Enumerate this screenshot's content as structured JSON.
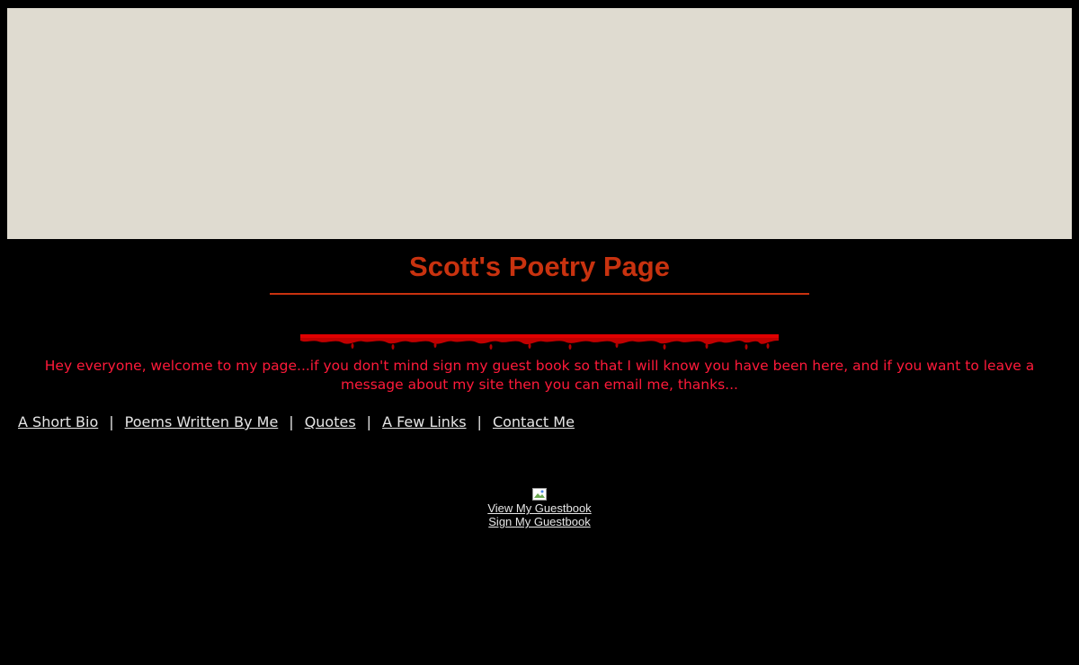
{
  "page": {
    "title": "Scott's Poetry Page",
    "welcome_text": "Hey everyone, welcome to my page...if you don't mind sign my guest book so that I will know you have been here, and if you want to leave a message about my site then you can email me, thanks..."
  },
  "nav": {
    "items": [
      {
        "label": "A Short Bio"
      },
      {
        "label": "Poems Written By Me"
      },
      {
        "label": "Quotes"
      },
      {
        "label": "A Few Links"
      },
      {
        "label": "Contact Me"
      }
    ],
    "separator": "|"
  },
  "guestbook": {
    "image_icon": "broken-image-icon",
    "view_label": "View My Guestbook",
    "sign_label": "Sign My Guestbook"
  },
  "colors": {
    "background": "#000000",
    "banner": "#dfdbd0",
    "title": "#c8320f",
    "welcome_text": "#ff1a3a",
    "links": "#e6e6e6",
    "drip": "#e00000"
  }
}
